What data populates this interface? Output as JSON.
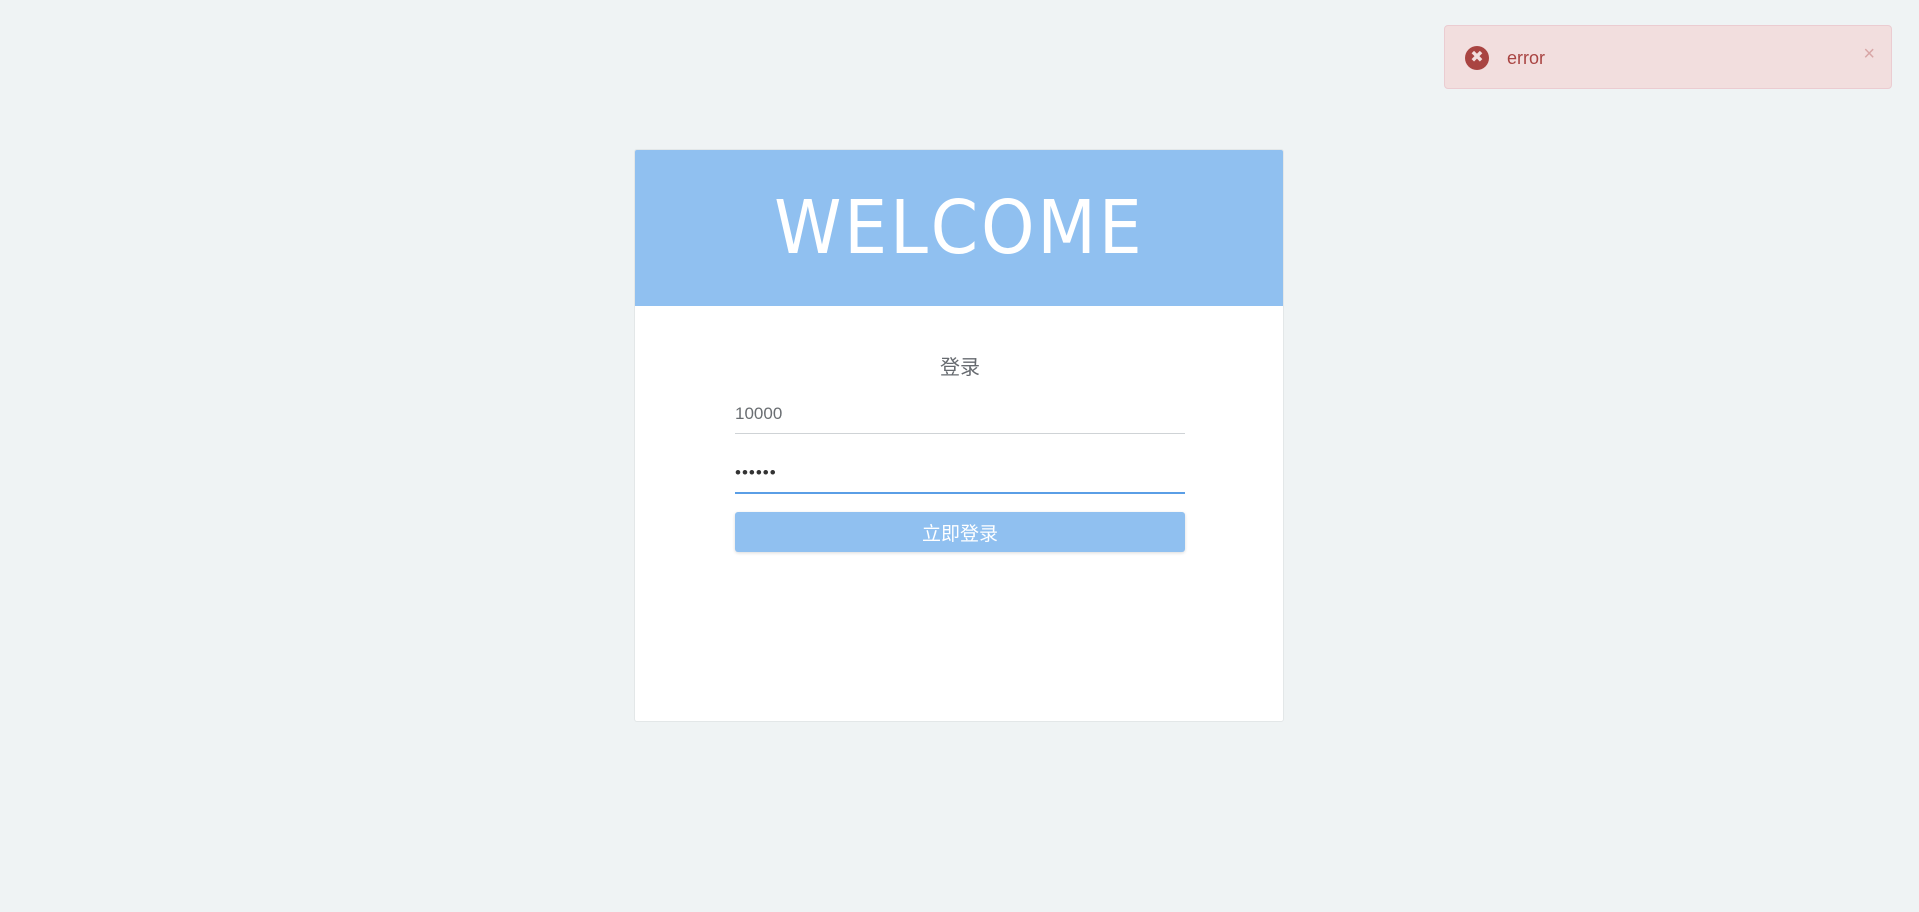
{
  "toast": {
    "icon": "error-circle-icon",
    "message": "error",
    "close_label": "×",
    "colors": {
      "background": "#f2dede",
      "text": "#a94442"
    }
  },
  "card": {
    "header_title": "WELCOME",
    "header_color": "#90c0f0",
    "form": {
      "title": "登录",
      "username_value": "10000",
      "password_value": "••••••",
      "submit_label": "立即登录"
    }
  }
}
